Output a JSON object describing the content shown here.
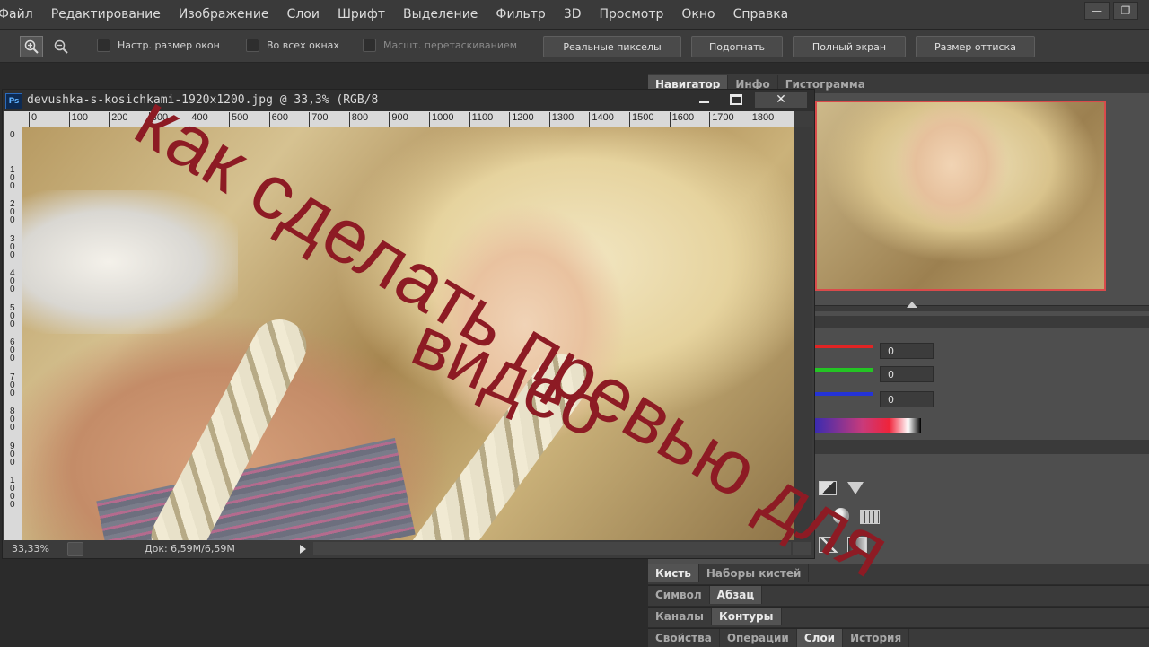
{
  "menu": [
    "Файл",
    "Редактирование",
    "Изображение",
    "Слои",
    "Шрифт",
    "Выделение",
    "Фильтр",
    "3D",
    "Просмотр",
    "Окно",
    "Справка"
  ],
  "window_controls": {
    "minimize": "—",
    "restore": "❐"
  },
  "options": {
    "resize_windows": "Настр. размер окон",
    "all_windows": "Во всех окнах",
    "scrubby_zoom": "Масшт. перетаскиванием",
    "actual_pixels": "Реальные пикселы",
    "fit": "Подогнать",
    "full_screen": "Полный экран",
    "print_size": "Размер оттиска"
  },
  "document": {
    "title": "devushka-s-kosichkami-1920x1200.jpg @ 33,3% (RGB/8",
    "zoom": "33,33%",
    "doc_size": "Док: 6,59M/6,59M",
    "ruler_h": [
      "0",
      "100",
      "200",
      "300",
      "400",
      "500",
      "600",
      "700",
      "800",
      "900",
      "1000",
      "1100",
      "1200",
      "1300",
      "1400",
      "1500",
      "1600",
      "1700",
      "1800"
    ],
    "ruler_v": [
      "0",
      "1 0 0",
      "2 0 0",
      "3 0 0",
      "4 0 0",
      "5 0 0",
      "6 0 0",
      "7 0 0",
      "8 0 0",
      "9 0 0",
      "1 0 0 0"
    ]
  },
  "panels": {
    "top_tabs": [
      "Навигатор",
      "Инфо",
      "Гистограмма"
    ],
    "color_values": [
      "0",
      "0",
      "0"
    ],
    "brush_tabs": [
      "Кисть",
      "Наборы кистей"
    ],
    "type_tabs": [
      "Символ",
      "Абзац"
    ],
    "channel_tabs": [
      "Каналы",
      "Контуры"
    ],
    "bottom_tabs": [
      "Свойства",
      "Операции",
      "Слои",
      "История"
    ]
  },
  "overlay": {
    "line1": "как сделать превью для",
    "line2": "видео",
    "color": "#8d1b24"
  }
}
